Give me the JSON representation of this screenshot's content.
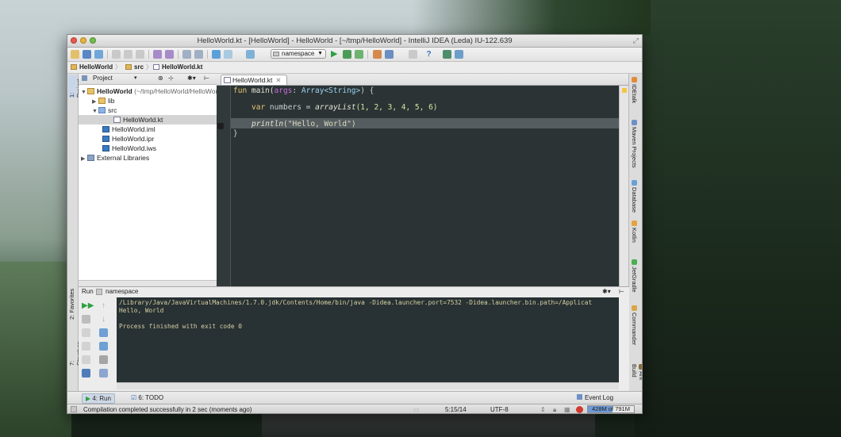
{
  "window": {
    "title": "HelloWorld.kt - [HelloWorld] - HelloWorld - [~/tmp/HelloWorld] - IntelliJ IDEA (Leda) IU-122.639"
  },
  "toolbar": {
    "run_config": "namespace"
  },
  "navbar": {
    "crumbs": [
      "HelloWorld",
      "src",
      "HelloWorld.kt"
    ]
  },
  "left_strip": {
    "project": "1: Project",
    "favorites": "2: Favorites",
    "structure": "7: Structure"
  },
  "project_panel": {
    "header": "Project",
    "tree": [
      {
        "name": "HelloWorld",
        "suffix": "(~/tmp/HelloWorld/HelloWorld)"
      },
      {
        "name": "lib"
      },
      {
        "name": "src"
      },
      {
        "name": "HelloWorld.kt"
      },
      {
        "name": "HelloWorld.iml"
      },
      {
        "name": "HelloWorld.ipr"
      },
      {
        "name": "HelloWorld.iws"
      },
      {
        "name": "External Libraries"
      }
    ]
  },
  "editor": {
    "tab": "HelloWorld.kt",
    "code": {
      "l1_kw": "fun ",
      "l1_name": "main(",
      "l1_param": "args",
      "l1_colon": ": ",
      "l1_type": "Array<String>",
      "l1_end": ") {",
      "l2_kw": "var ",
      "l2_name": "numbers = ",
      "l2_fn": "arrayList",
      "l2_args": "(1, 2, 3, 4, 5, 6)",
      "l3_fn": "println",
      "l3_args": "(\"Hello, World\")",
      "l4": "}"
    }
  },
  "right_strip": [
    "IDEtalk",
    "Maven Projects",
    "Database",
    "Kotlin",
    "JetGradle",
    "Commander",
    "Ant Build"
  ],
  "run_panel": {
    "label": "Run",
    "config": "namespace",
    "console": [
      "/Library/Java/JavaVirtualMachines/1.7.0.jdk/Contents/Home/bin/java -Didea.launcher.port=7532 -Didea.launcher.bin.path=/Applicat",
      "Hello, World",
      "",
      "Process finished with exit code 0"
    ]
  },
  "bottom_tabs": {
    "run": "4: Run",
    "todo": "6: TODO",
    "event_log": "Event Log"
  },
  "status": {
    "message": "Compilation completed successfully in 2 sec (moments ago)",
    "position": "5:15/14",
    "encoding": "UTF-8",
    "memory": "428M of 791M",
    "memory_fraction": 0.54
  }
}
